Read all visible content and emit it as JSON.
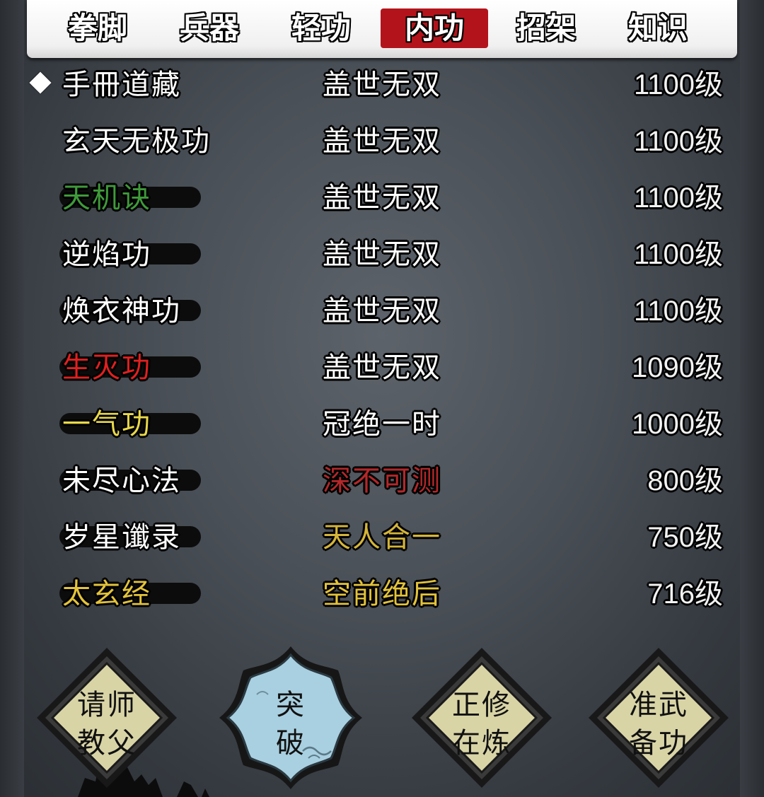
{
  "tabs": [
    {
      "label": "拳脚",
      "active": false
    },
    {
      "label": "兵器",
      "active": false
    },
    {
      "label": "轻功",
      "active": false
    },
    {
      "label": "内功",
      "active": true
    },
    {
      "label": "招架",
      "active": false
    },
    {
      "label": "知识",
      "active": false
    }
  ],
  "skills": [
    {
      "name": "手冊道藏",
      "rank": "盖世无双",
      "level": "1100级",
      "name_color": "#ffffff",
      "rank_color": "#ffffff",
      "selected": true,
      "partial": true
    },
    {
      "name": "玄天无极功",
      "rank": "盖世无双",
      "level": "1100级",
      "name_color": "#ffffff",
      "rank_color": "#ffffff",
      "selected": false
    },
    {
      "name": "天机诀",
      "rank": "盖世无双",
      "level": "1100级",
      "name_color": "#3f9a3a",
      "rank_color": "#ffffff",
      "selected": false
    },
    {
      "name": "逆焰功",
      "rank": "盖世无双",
      "level": "1100级",
      "name_color": "#ffffff",
      "rank_color": "#ffffff",
      "selected": false
    },
    {
      "name": "焕衣神功",
      "rank": "盖世无双",
      "level": "1100级",
      "name_color": "#ffffff",
      "rank_color": "#ffffff",
      "selected": false
    },
    {
      "name": "生灭功",
      "rank": "盖世无双",
      "level": "1090级",
      "name_color": "#e02020",
      "rank_color": "#ffffff",
      "selected": false
    },
    {
      "name": "一气功",
      "rank": "冠绝一时",
      "level": "1000级",
      "name_color": "#e8d84a",
      "rank_color": "#ffffff",
      "selected": false
    },
    {
      "name": "未尽心法",
      "rank": "深不可测",
      "level": "800级",
      "name_color": "#ffffff",
      "rank_color": "#b3282a",
      "selected": false
    },
    {
      "name": "岁星谶录",
      "rank": "天人合一",
      "level": "750级",
      "name_color": "#ffffff",
      "rank_color": "#d4b53a",
      "selected": false
    },
    {
      "name": "太玄经",
      "rank": "空前绝后",
      "level": "716级",
      "name_color": "#e3c33b",
      "rank_color": "#e3c33b",
      "selected": false
    }
  ],
  "buttons": [
    {
      "line1": "请师",
      "line2": "教父",
      "style": "tan"
    },
    {
      "line1": "突",
      "line2": "破",
      "style": "blue"
    },
    {
      "line1": "正修",
      "line2": "在炼",
      "style": "tan"
    },
    {
      "line1": "准武",
      "line2": "备功",
      "style": "tan"
    }
  ],
  "colors": {
    "tab_active": "#b3141b",
    "button_tan": "#d9d4a6",
    "button_blue": "#a9d0e0"
  }
}
